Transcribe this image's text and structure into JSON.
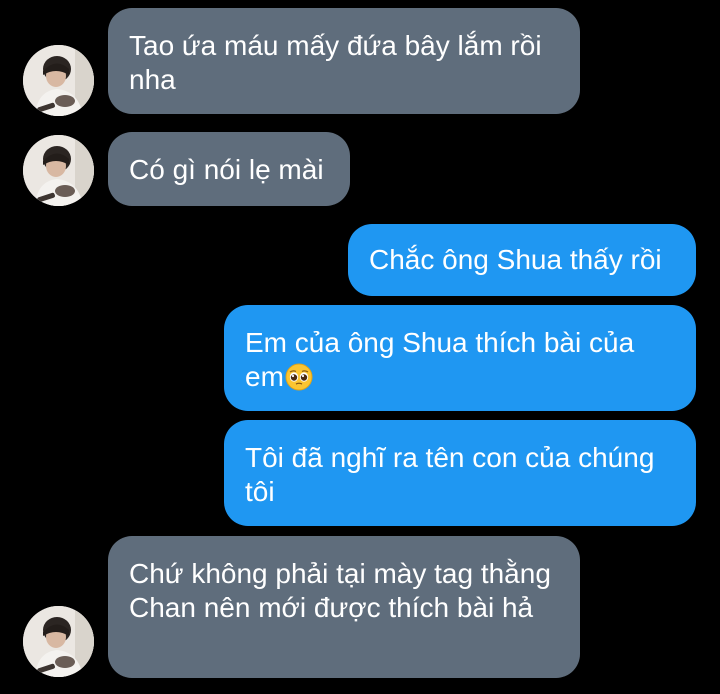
{
  "messages": [
    {
      "text": "Tao ứa máu mấy đứa bây lắm rồi nha"
    },
    {
      "text": "Có gì nói lẹ mài"
    },
    {
      "text": "Chắc ông Shua thấy rồi"
    },
    {
      "text": "Em của ông Shua thích bài của em",
      "emoji": "pleading-face"
    },
    {
      "text": "Tôi đã nghĩ ra tên con của chúng tôi"
    },
    {
      "text": "Chứ không phải tại mày tag thằng Chan nên mới được thích bài hả"
    }
  ],
  "colors": {
    "background": "#000000",
    "incoming_bubble": "#5f6d7c",
    "outgoing_bubble": "#1f97f2",
    "text": "#ffffff"
  }
}
